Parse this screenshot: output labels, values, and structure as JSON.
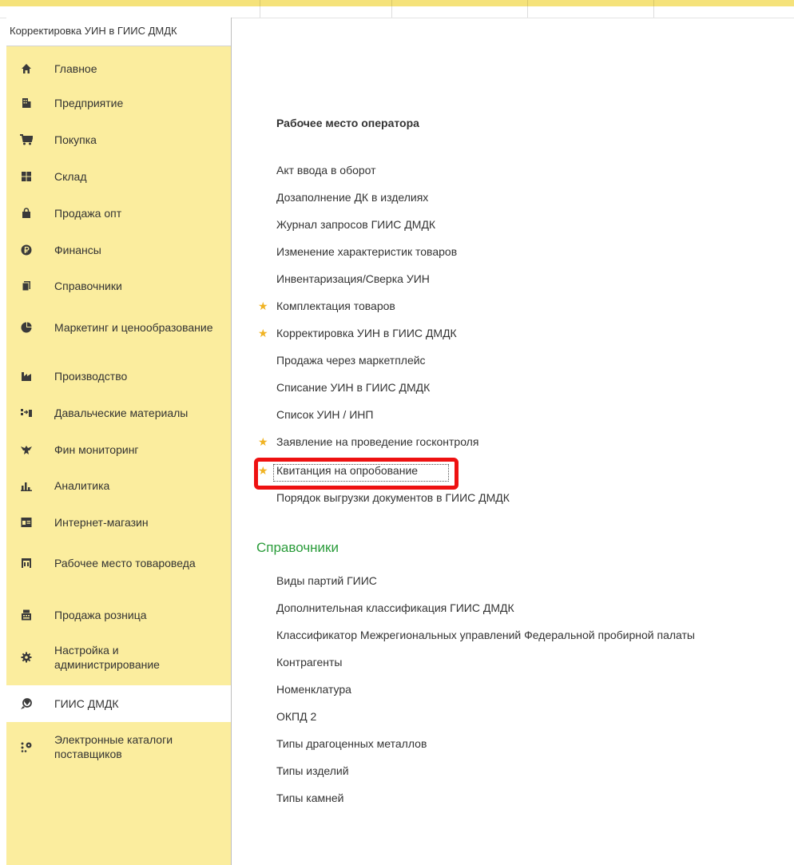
{
  "window": {
    "title": "Корректировка УИН в ГИИС ДМДК"
  },
  "sidebar": {
    "items": [
      {
        "label": "Главное",
        "icon": "home-icon"
      },
      {
        "label": "Предприятие",
        "icon": "building-icon"
      },
      {
        "label": "Покупка",
        "icon": "cart-icon"
      },
      {
        "label": "Склад",
        "icon": "warehouse-icon"
      },
      {
        "label": "Продажа опт",
        "icon": "bag-icon"
      },
      {
        "label": "Финансы",
        "icon": "ruble-icon"
      },
      {
        "label": "Справочники",
        "icon": "books-icon"
      },
      {
        "label": "Маркетинг и ценообразование",
        "icon": "pie-chart-icon"
      },
      {
        "label": "Производство",
        "icon": "factory-icon"
      },
      {
        "label": "Давальческие материалы",
        "icon": "materials-icon"
      },
      {
        "label": "Фин мониторинг",
        "icon": "eagle-icon"
      },
      {
        "label": "Аналитика",
        "icon": "bar-chart-icon"
      },
      {
        "label": "Интернет-магазин",
        "icon": "web-store-icon"
      },
      {
        "label": "Рабочее место товароведа",
        "icon": "workplace-icon"
      },
      {
        "label": "Продажа розница",
        "icon": "register-icon"
      },
      {
        "label": "Настройка и администрирование",
        "icon": "gear-icon"
      },
      {
        "label": "ГИИС ДМДК",
        "icon": "gems-icon",
        "active": true
      },
      {
        "label": "Электронные каталоги поставщиков",
        "icon": "catalog-icon"
      }
    ]
  },
  "main": {
    "operator_section": {
      "title": "Рабочее место оператора",
      "links": [
        {
          "label": "Акт ввода в оборот",
          "starred": false
        },
        {
          "label": "Дозаполнение ДК в изделиях",
          "starred": false
        },
        {
          "label": "Журнал запросов ГИИС ДМДК",
          "starred": false
        },
        {
          "label": "Изменение характеристик товаров",
          "starred": false
        },
        {
          "label": "Инвентаризация/Сверка УИН",
          "starred": false
        },
        {
          "label": "Комплектация товаров",
          "starred": true
        },
        {
          "label": "Корректировка УИН в ГИИС ДМДК",
          "starred": true
        },
        {
          "label": "Продажа через маркетплейс",
          "starred": false
        },
        {
          "label": "Списание УИН в ГИИС ДМДК",
          "starred": false
        },
        {
          "label": "Список УИН / ИНП",
          "starred": false
        },
        {
          "label": "Заявление на проведение госконтроля",
          "starred": true
        },
        {
          "label": "Квитанция на опробование",
          "starred": true,
          "highlighted": true
        },
        {
          "label": "Порядок выгрузки документов в ГИИС ДМДК",
          "starred": false
        }
      ]
    },
    "references_section": {
      "title": "Справочники",
      "links": [
        "Виды партий ГИИС",
        "Дополнительная классификация ГИИС ДМДК",
        "Классификатор Межрегиональных управлений Федеральной пробирной палаты",
        "Контрагенты",
        "Номенклатура",
        "ОКПД 2",
        "Типы драгоценных металлов",
        "Типы изделий",
        "Типы камней"
      ]
    }
  },
  "colors": {
    "sidebar_bg": "#fbed9e",
    "section_green": "#2a9c3a",
    "star": "#f0b323",
    "highlight_red": "#ee1111"
  }
}
